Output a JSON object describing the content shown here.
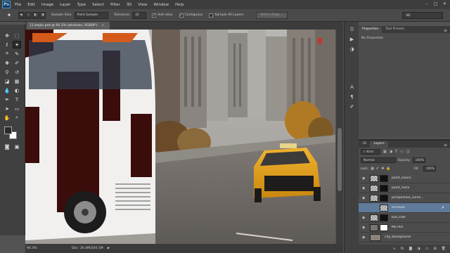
{
  "menubar": {
    "logo": "Ps",
    "items": [
      "File",
      "Edit",
      "Image",
      "Layer",
      "Type",
      "Select",
      "Filter",
      "3D",
      "View",
      "Window",
      "Help"
    ]
  },
  "options": {
    "sample_size_label": "Sample Size:",
    "sample_size_value": "Point Sample",
    "tolerance_label": "Tolerance:",
    "tolerance_value": "32",
    "antialias": "Anti-alias",
    "contiguous": "Contiguous",
    "sample_all_layers": "Sample All Layers",
    "refine_edge": "Refine Edge...",
    "workspace": "3D"
  },
  "document": {
    "tab_title": "11 begin.psd @ 94.3% (windows, RGB/8*)",
    "tab_close": "×",
    "zoom": "94.3%",
    "doc_info": "Doc: 26.4M/100.1M"
  },
  "properties": {
    "tabs": [
      "Properties",
      "Tool Presets"
    ],
    "empty_text": "No Properties"
  },
  "layers": {
    "tabs": [
      "3D",
      "Layers"
    ],
    "filter_kind": "Kind",
    "blend_mode": "Normal",
    "opacity_label": "Opacity:",
    "opacity_value": "100%",
    "lock_label": "Lock:",
    "fill_label": "Fill:",
    "fill_value": "100%",
    "items": [
      {
        "name": "paint_color2",
        "thumb": "checker",
        "mask": true,
        "visible": true,
        "selected": false
      },
      {
        "name": "paint_roof2",
        "thumb": "checker",
        "mask": true,
        "visible": true,
        "selected": false
      },
      {
        "name": "perspective_corne...",
        "thumb": "checker",
        "mask": true,
        "visible": true,
        "selected": false
      },
      {
        "name": "windows",
        "thumb": "checker",
        "mask": false,
        "visible": false,
        "selected": true
      },
      {
        "name": "bus_side",
        "thumb": "checker",
        "mask": true,
        "visible": true,
        "selected": false
      },
      {
        "name": "METRO",
        "thumb": "photo",
        "mask": true,
        "visible": true,
        "selected": false
      },
      {
        "name": "city_background",
        "thumb": "photo",
        "mask": false,
        "visible": true,
        "selected": false
      }
    ]
  },
  "colors": {
    "foreground": "#2a2a2a",
    "background": "#ffffff",
    "selection": "#5f7a9a"
  }
}
